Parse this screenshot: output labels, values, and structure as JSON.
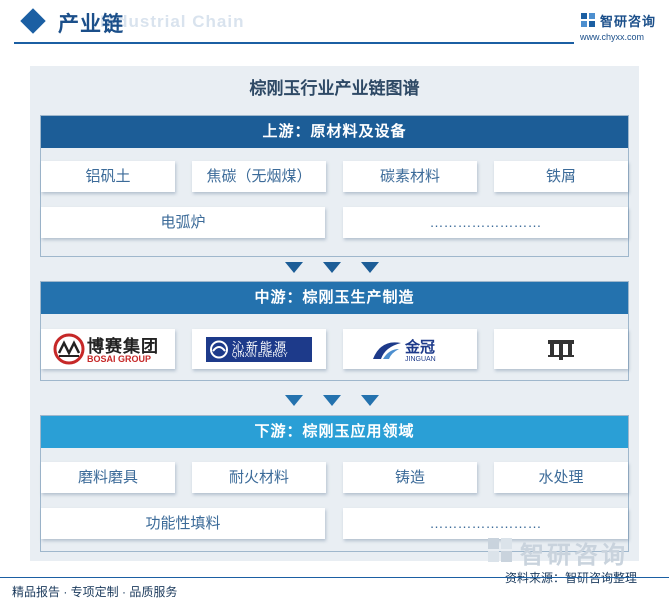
{
  "header": {
    "title": "产业链",
    "subtitle_en": "Industrial Chain",
    "logo_name": "智研咨询",
    "logo_url": "www.chyxx.com"
  },
  "diagram": {
    "title": "棕刚玉行业产业链图谱",
    "upstream": {
      "title": "上游：原材料及设备",
      "items": [
        "铝矾土",
        "焦碳（无烟煤）",
        "碳素材料",
        "铁屑",
        "电弧炉",
        "……………………"
      ]
    },
    "midstream": {
      "title": "中游：棕刚玉生产制造",
      "companies": [
        {
          "name": "博赛集团",
          "name_en": "BOSAI GROUP"
        },
        {
          "name": "沁新能源",
          "name_en": "QINXIN ENERGY"
        },
        {
          "name": "金冠",
          "name_en": "JINGUAN"
        },
        {
          "name": "",
          "name_en": ""
        }
      ]
    },
    "downstream": {
      "title": "下游：棕刚玉应用领域",
      "items": [
        "磨料磨具",
        "耐火材料",
        "铸造",
        "水处理",
        "功能性填料",
        "……………………"
      ]
    }
  },
  "footer": {
    "left": "精品报告 · 专项定制 · 品质服务",
    "source": "资料来源：智研咨询整理",
    "watermark": "智研咨询"
  },
  "colors": {
    "upstream_header": "#1c5d97",
    "midstream_header": "#2472ae",
    "downstream_header": "#2a9fd6",
    "frame_bg": "#e9eef3",
    "accent": "#1b5fa3"
  }
}
